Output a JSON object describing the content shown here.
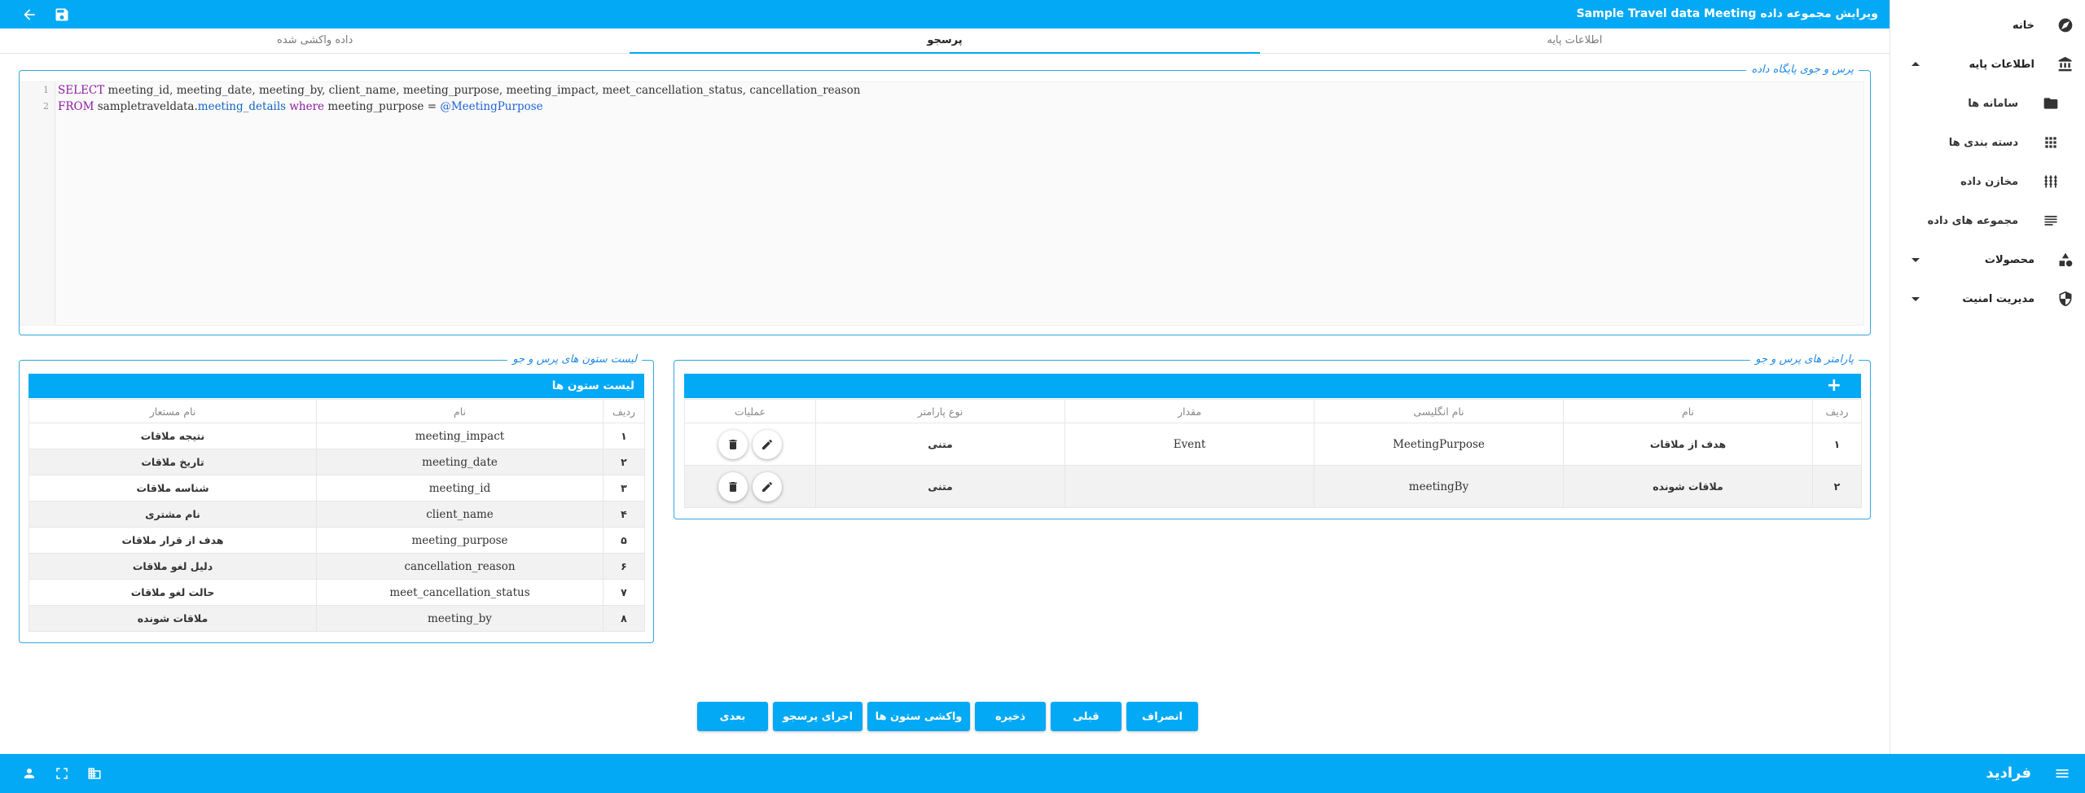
{
  "header": {
    "title": "ویرایش مجموعه داده Sample Travel data Meeting",
    "back_icon": "arrow-left-icon",
    "save_icon": "floppy-disk-icon"
  },
  "tabs": [
    {
      "label": "اطلاعات پایه",
      "active": false
    },
    {
      "label": "پرسجو",
      "active": true
    },
    {
      "label": "داده واکشی شده",
      "active": false
    }
  ],
  "query_panel": {
    "legend": "پرس و جوی پایگاه داده",
    "line_numbers": [
      "1",
      "2"
    ],
    "line1": {
      "kw": "SELECT",
      "rest": " meeting_id, meeting_date, meeting_by, client_name, meeting_purpose, meeting_impact, meet_cancellation_status, cancellation_reason"
    },
    "line2": {
      "kw1": "FROM",
      "schema": " sampletraveldata.",
      "table": "meeting_details",
      "kw2": " where",
      "rest": " meeting_purpose = ",
      "param": "@MeetingPurpose"
    }
  },
  "columns_panel": {
    "legend": "لیست ستون های پرس و جو",
    "title": "لیست ستون ها",
    "headers": {
      "row": "ردیف",
      "name": "نام",
      "alias": "نام مستعار"
    },
    "rows": [
      {
        "row": "۱",
        "name": "meeting_impact",
        "alias": "نتیجه ملاقات"
      },
      {
        "row": "۲",
        "name": "meeting_date",
        "alias": "تاریخ ملاقات"
      },
      {
        "row": "۳",
        "name": "meeting_id",
        "alias": "شناسه ملاقات"
      },
      {
        "row": "۴",
        "name": "client_name",
        "alias": "نام مشتری"
      },
      {
        "row": "۵",
        "name": "meeting_purpose",
        "alias": "هدف از قرار ملاقات"
      },
      {
        "row": "۶",
        "name": "cancellation_reason",
        "alias": "دلیل لغو ملاقات"
      },
      {
        "row": "۷",
        "name": "meet_cancellation_status",
        "alias": "حالت لغو ملاقات"
      },
      {
        "row": "۸",
        "name": "meeting_by",
        "alias": "ملاقات شونده"
      }
    ]
  },
  "params_panel": {
    "legend": "پارامتر های پرس و جو",
    "add_label": "+",
    "headers": {
      "row": "ردیف",
      "name": "نام",
      "en_name": "نام انگلیسی",
      "value": "مقدار",
      "type": "نوع پارامتر",
      "ops": "عملیات"
    },
    "rows": [
      {
        "row": "۱",
        "name": "هدف از ملاقات",
        "en_name": "MeetingPurpose",
        "value": "Event",
        "type": "متنی"
      },
      {
        "row": "۲",
        "name": "ملاقات شونده",
        "en_name": "meetingBy",
        "value": "",
        "type": "متنی"
      }
    ]
  },
  "actions": {
    "next": "بعدی",
    "run": "اجرای پرسجو",
    "fetch_columns": "واکشی ستون ها",
    "save": "ذخیره",
    "prev": "قبلی",
    "cancel": "انصراف"
  },
  "sidebar": {
    "home": "خانه",
    "base_info": "اطلاعات پایه",
    "systems": "سامانه ها",
    "categories": "دسته بندی ها",
    "repositories": "مخازن داده",
    "datasets": "مجموعه های داده",
    "products": "محصولات",
    "security": "مدیریت امنیت"
  },
  "statusbar": {
    "brand": "فرادید"
  },
  "colors": {
    "accent": "#03a9f4",
    "legend": "#1e88e5",
    "keyword": "#8b1ca0"
  }
}
